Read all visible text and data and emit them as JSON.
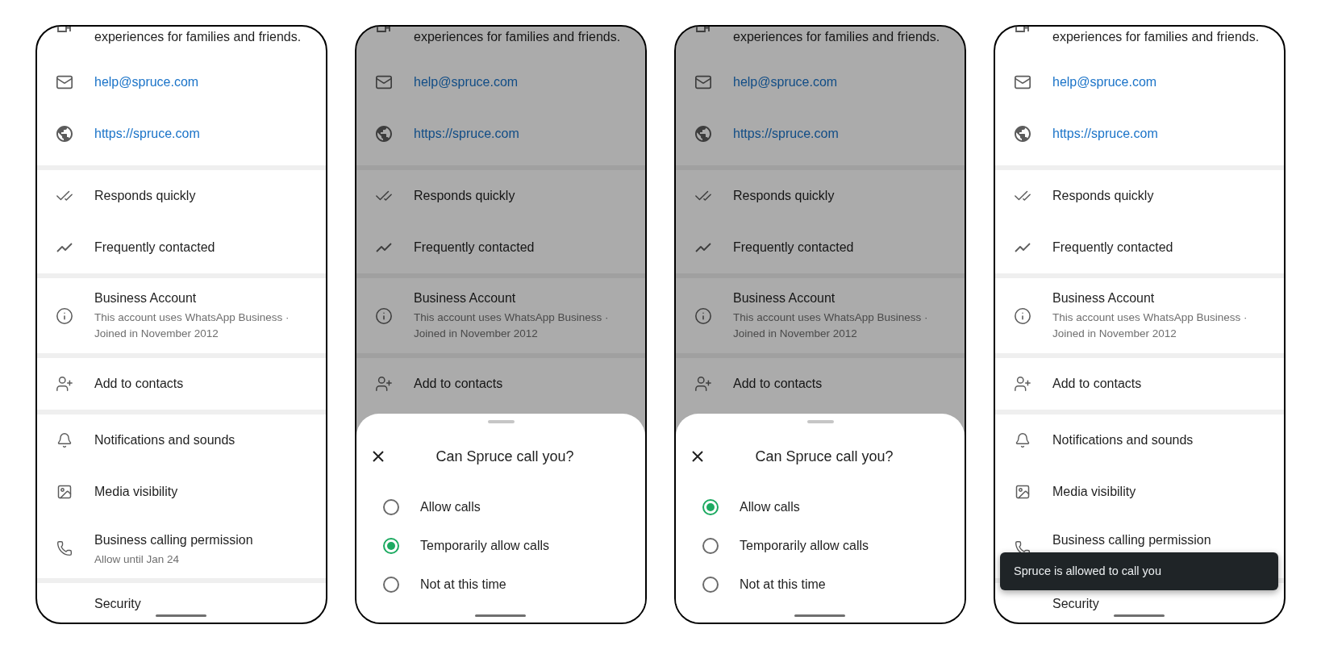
{
  "screens": [
    {
      "sections": [
        {
          "rows": [
            {
              "kind": "description",
              "title": "experiences for families and friends."
            },
            {
              "kind": "email",
              "title": "help@spruce.com"
            },
            {
              "kind": "website",
              "title": "https://spruce.com"
            }
          ]
        },
        {
          "rows": [
            {
              "kind": "responsiveness",
              "title": "Responds quickly"
            },
            {
              "kind": "frequency",
              "title": "Frequently contacted"
            }
          ]
        },
        {
          "rows": [
            {
              "kind": "account",
              "title": "Business Account",
              "subtitle": [
                "This account uses WhatsApp Business ·",
                "Joined in November 2012"
              ]
            }
          ]
        },
        {
          "rows": [
            {
              "kind": "contact",
              "title": "Add to contacts"
            }
          ]
        },
        {
          "rows": [
            {
              "kind": "notifications",
              "title": "Notifications and sounds"
            },
            {
              "kind": "media",
              "title": "Media visibility"
            },
            {
              "kind": "calling",
              "title": "Business calling permission",
              "subtitle": [
                "Allow until Jan 24"
              ]
            }
          ]
        },
        {
          "rows": [
            {
              "kind": "security",
              "title": "Security"
            }
          ]
        }
      ]
    },
    {
      "sections": [
        {
          "rows": [
            {
              "kind": "description",
              "title": "experiences for families and friends."
            },
            {
              "kind": "email",
              "title": "help@spruce.com"
            },
            {
              "kind": "website",
              "title": "https://spruce.com"
            }
          ]
        },
        {
          "rows": [
            {
              "kind": "responsiveness",
              "title": "Responds quickly"
            },
            {
              "kind": "frequency",
              "title": "Frequently contacted"
            }
          ]
        },
        {
          "rows": [
            {
              "kind": "account",
              "title": "Business Account",
              "subtitle": [
                "This account uses WhatsApp Business ·",
                "Joined in November 2012"
              ]
            }
          ]
        },
        {
          "rows": [
            {
              "kind": "contact",
              "title": "Add to contacts"
            }
          ]
        }
      ],
      "sheet": {
        "title": "Can Spruce call you?",
        "options": [
          {
            "label": "Allow calls",
            "selected": false
          },
          {
            "label": "Temporarily allow calls",
            "selected": true
          },
          {
            "label": "Not at this time",
            "selected": false
          }
        ]
      }
    },
    {
      "sections": [
        {
          "rows": [
            {
              "kind": "description",
              "title": "experiences for families and friends."
            },
            {
              "kind": "email",
              "title": "help@spruce.com"
            },
            {
              "kind": "website",
              "title": "https://spruce.com"
            }
          ]
        },
        {
          "rows": [
            {
              "kind": "responsiveness",
              "title": "Responds quickly"
            },
            {
              "kind": "frequency",
              "title": "Frequently contacted"
            }
          ]
        },
        {
          "rows": [
            {
              "kind": "account",
              "title": "Business Account",
              "subtitle": [
                "This account uses WhatsApp Business ·",
                "Joined in November 2012"
              ]
            }
          ]
        },
        {
          "rows": [
            {
              "kind": "contact",
              "title": "Add to contacts"
            }
          ]
        }
      ],
      "sheet": {
        "title": "Can Spruce call you?",
        "options": [
          {
            "label": "Allow calls",
            "selected": true
          },
          {
            "label": "Temporarily allow calls",
            "selected": false
          },
          {
            "label": "Not at this time",
            "selected": false
          }
        ]
      }
    },
    {
      "sections": [
        {
          "rows": [
            {
              "kind": "description",
              "title": "experiences for families and friends."
            },
            {
              "kind": "email",
              "title": "help@spruce.com"
            },
            {
              "kind": "website",
              "title": "https://spruce.com"
            }
          ]
        },
        {
          "rows": [
            {
              "kind": "responsiveness",
              "title": "Responds quickly"
            },
            {
              "kind": "frequency",
              "title": "Frequently contacted"
            }
          ]
        },
        {
          "rows": [
            {
              "kind": "account",
              "title": "Business Account",
              "subtitle": [
                "This account uses WhatsApp Business ·",
                "Joined in November 2012"
              ]
            }
          ]
        },
        {
          "rows": [
            {
              "kind": "contact",
              "title": "Add to contacts"
            }
          ]
        },
        {
          "rows": [
            {
              "kind": "notifications",
              "title": "Notifications and sounds"
            },
            {
              "kind": "media",
              "title": "Media visibility"
            },
            {
              "kind": "calling",
              "title": "Business calling permission"
            }
          ]
        },
        {
          "rows": [
            {
              "kind": "security",
              "title": "Security"
            }
          ]
        }
      ],
      "toast": "Spruce is allowed to call you"
    }
  ]
}
